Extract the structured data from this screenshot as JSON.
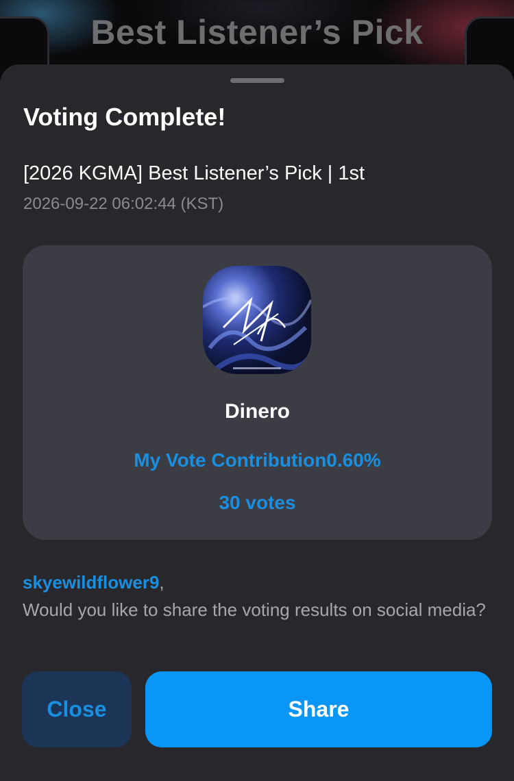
{
  "background": {
    "title": "Best Listener’s Pick"
  },
  "sheet": {
    "title": "Voting Complete!",
    "event_name": "[2026 KGMA] Best Listener’s Pick | 1st",
    "event_time": "2026-09-22 06:02:44 (KST)"
  },
  "card": {
    "artist": "Dinero",
    "contribution": "My Vote Contribution0.60%",
    "votes": "30 votes"
  },
  "share_prompt": {
    "username": "skyewildflower9",
    "comma": ",",
    "message": "Would you like to share the voting results on social media?"
  },
  "buttons": {
    "close_label": "Close",
    "share_label": "Share"
  },
  "colors": {
    "accent": "#1a8fe0",
    "share_button": "#0a96f7",
    "close_button": "#1c3557",
    "sheet_bg": "#28282c",
    "card_bg": "#3c3c44"
  }
}
